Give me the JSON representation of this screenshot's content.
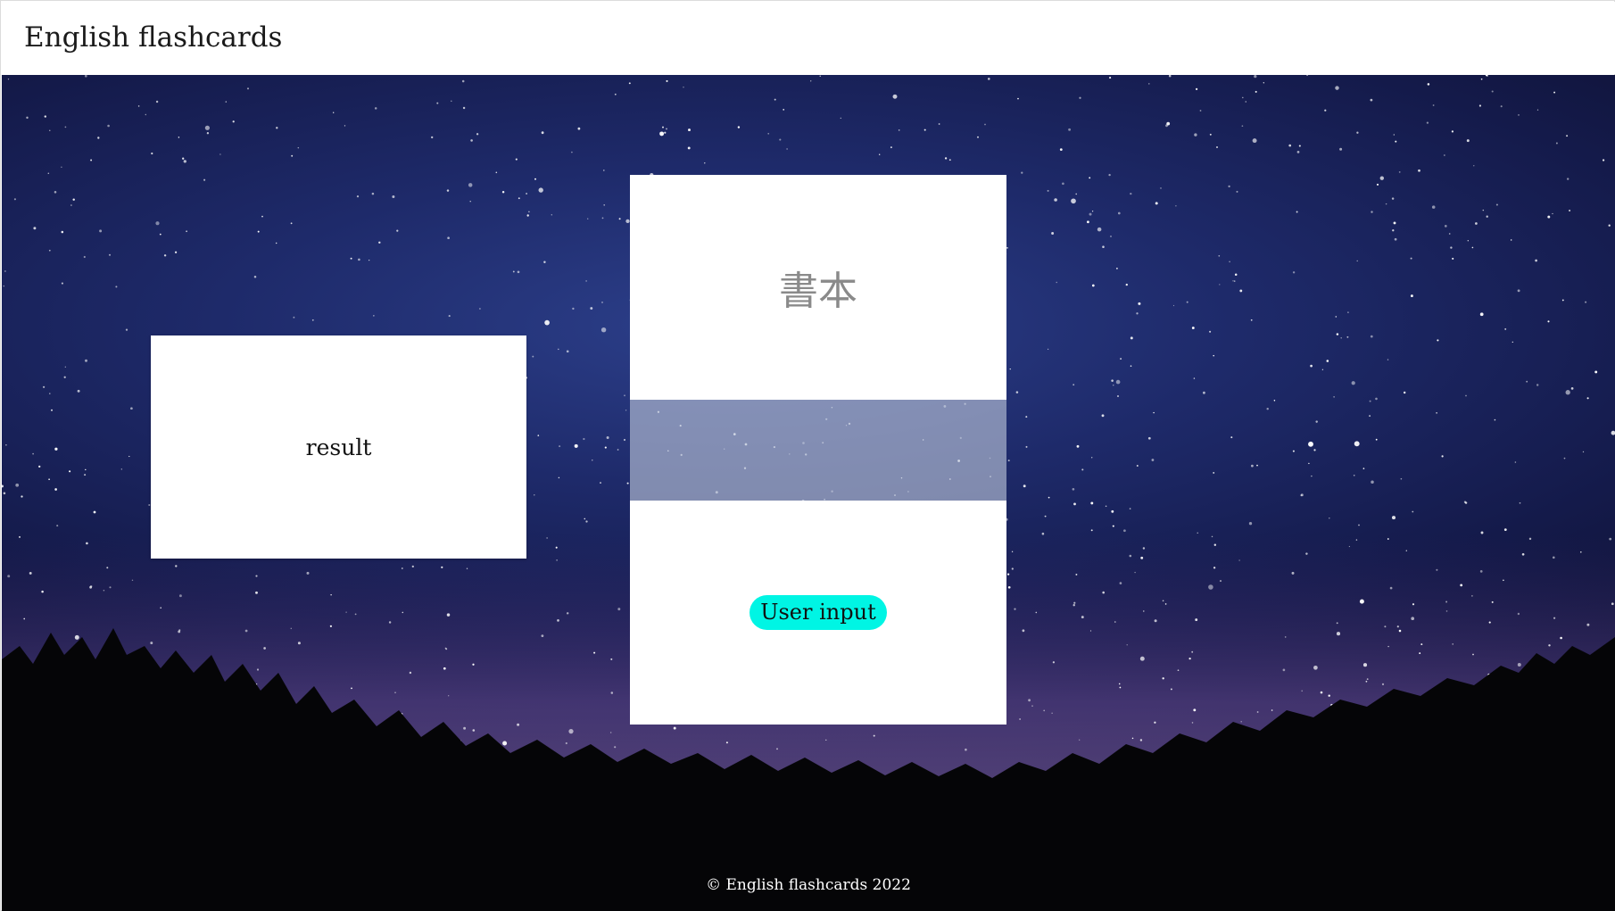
{
  "header": {
    "title": "English flashcards"
  },
  "result_card": {
    "label": "result"
  },
  "flashcard": {
    "word": "書本",
    "input_button_label": "User input"
  },
  "footer": {
    "copyright": "© English flashcards 2022"
  },
  "colors": {
    "accent": "#00f5e4",
    "sky": "#1e2a6a",
    "word_text": "#8a8a8a"
  }
}
